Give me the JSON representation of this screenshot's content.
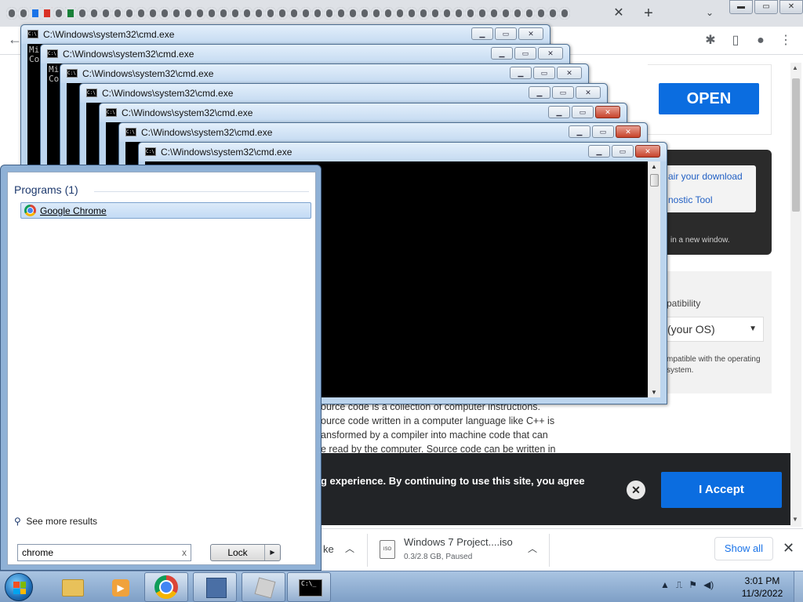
{
  "browser": {
    "tab_close": "✕",
    "new_tab": "+",
    "tab_search": "⌄",
    "window_buttons": [
      "▬",
      "▭",
      "✕"
    ],
    "toolbar": {
      "back": "←",
      "extensions": "✱",
      "sidebar": "▯",
      "profile": "●",
      "menu": "⋮"
    }
  },
  "page": {
    "open_button": "OPEN",
    "download_links": [
      "air your download",
      "nostic Tool"
    ],
    "download_note": "in a new window.",
    "compat_title": "patibility",
    "os_select": "(your OS)",
    "compat_desc": "mpatible with the operating system.",
    "article": [
      "ource code is a collection of computer instructions.",
      "ource code written in a computer language like C++ is",
      "ansformed by a compiler into machine code that can",
      "e read by the computer. Source code can be written in"
    ],
    "cookie_text": "g experience. By continuing to use this site, you agree",
    "cookie_sub": "",
    "cookie_close": "✕",
    "accept_button": "I Accept"
  },
  "downloads": {
    "partial_ext": "ke",
    "file_name": "Windows 7 Project....iso",
    "file_status": "0.3/2.8 GB, Paused",
    "file_icon": "ISO",
    "show_all": "Show all",
    "close": "✕"
  },
  "cmd_windows": {
    "title": "C:\\Windows\\system32\\cmd.exe",
    "console_lines_1": [
      "Mi",
      "Co"
    ],
    "console_lines_2": [
      "Mi",
      "Co"
    ]
  },
  "start_menu": {
    "programs_header": "Programs (1)",
    "program_item": "Google Chrome",
    "see_more": "See more results",
    "search_value": "chrome",
    "search_clear": "x",
    "lock_label": "Lock",
    "lock_arrow": "▶"
  },
  "taskbar": {
    "time": "3:01 PM",
    "date": "11/3/2022",
    "tray_icons": [
      "▲",
      "⎍",
      "⚑",
      "◀)"
    ]
  }
}
